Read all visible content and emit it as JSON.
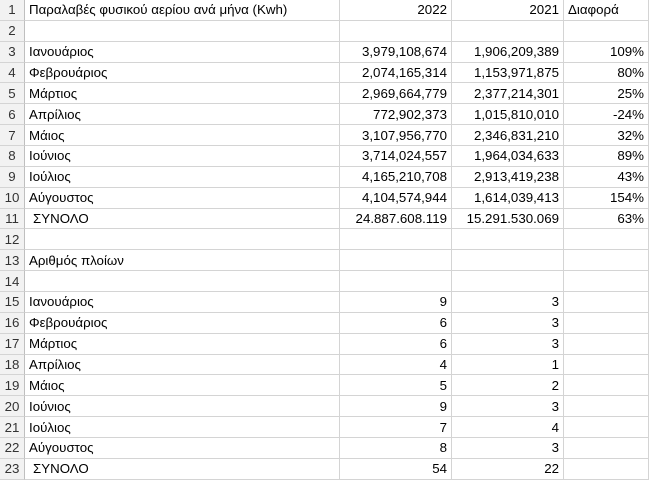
{
  "rows": [
    [
      "1",
      "Παραλαβές φυσικού αερίου ανά μήνα (Kwh)",
      "2022",
      "2021",
      "Διαφορά"
    ],
    [
      "2",
      "",
      "",
      "",
      ""
    ],
    [
      "3",
      "Ιανουάριος",
      "3,979,108,674",
      "1,906,209,389",
      "109%"
    ],
    [
      "4",
      "Φεβρουάριος",
      "2,074,165,314",
      "1,153,971,875",
      "80%"
    ],
    [
      "5",
      "Μάρτιος",
      "2,969,664,779",
      "2,377,214,301",
      "25%"
    ],
    [
      "6",
      "Απρίλιος",
      "772,902,373",
      "1,015,810,010",
      "-24%"
    ],
    [
      "7",
      "Μάιος",
      "3,107,956,770",
      "2,346,831,210",
      "32%"
    ],
    [
      "8",
      "Ιούνιος",
      "3,714,024,557",
      "1,964,034,633",
      "89%"
    ],
    [
      "9",
      "Ιούλιος",
      "4,165,210,708",
      "2,913,419,238",
      "43%"
    ],
    [
      "10",
      "Αύγουστος",
      "4,104,574,944",
      "1,614,039,413",
      "154%"
    ],
    [
      "11",
      " ΣΥΝΟΛΟ",
      "24.887.608.119",
      "15.291.530.069",
      "63%"
    ],
    [
      "12",
      "",
      "",
      "",
      ""
    ],
    [
      "13",
      "Αριθμός πλοίων",
      "",
      "",
      ""
    ],
    [
      "14",
      "",
      "",
      "",
      ""
    ],
    [
      "15",
      "Ιανουάριος",
      "9",
      "3",
      ""
    ],
    [
      "16",
      "Φεβρουάριος",
      "6",
      "3",
      ""
    ],
    [
      "17",
      "Μάρτιος",
      "6",
      "3",
      ""
    ],
    [
      "18",
      "Απρίλιος",
      "4",
      "1",
      ""
    ],
    [
      "19",
      "Μάιος",
      "5",
      "2",
      ""
    ],
    [
      "20",
      "Ιούνιος",
      "9",
      "3",
      ""
    ],
    [
      "21",
      "Ιούλιος",
      "7",
      "4",
      ""
    ],
    [
      "22",
      "Αύγουστος",
      "8",
      "3",
      ""
    ],
    [
      "23",
      " ΣΥΝΟΛΟ",
      "54",
      "22",
      ""
    ]
  ]
}
